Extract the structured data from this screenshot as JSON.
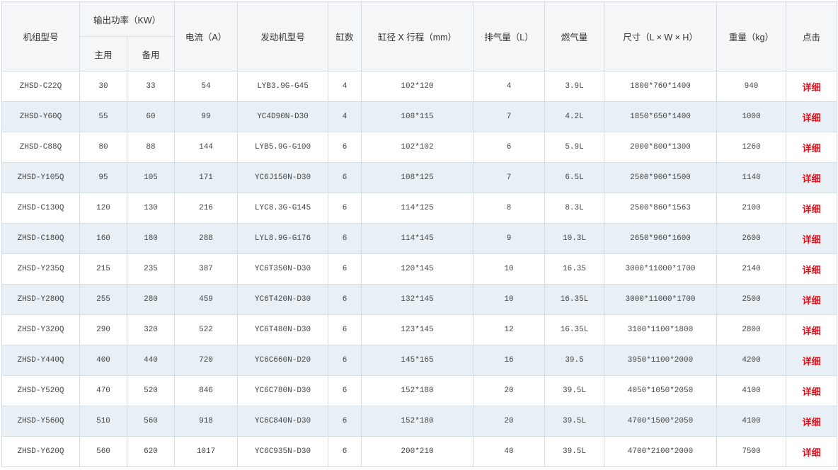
{
  "headers": {
    "model": "机组型号",
    "power": "输出功率（KW）",
    "main": "主用",
    "standby": "备用",
    "current": "电流（A）",
    "engine": "发动机型号",
    "cylinders": "缸数",
    "bore_stroke": "缸径 X 行程（mm）",
    "displacement": "排气量（L）",
    "fuel": "燃气量",
    "size": "尺寸（L × W × H）",
    "weight": "重量（kg）",
    "action": "点击"
  },
  "accent_color": "#e0101d",
  "row_stripe_color": "#e8f0f5",
  "rows": [
    {
      "model": "ZHSD-C22Q",
      "main": "30",
      "standby": "33",
      "current": "54",
      "engine": "LYB3.9G-G45",
      "cylinders": "4",
      "bore_stroke": "102*120",
      "displacement": "4",
      "fuel": "3.9L",
      "size": "1800*760*1400",
      "weight": "940",
      "detail": "详细"
    },
    {
      "model": "ZHSD-Y60Q",
      "main": "55",
      "standby": "60",
      "current": "99",
      "engine": "YC4D90N-D30",
      "cylinders": "4",
      "bore_stroke": "108*115",
      "displacement": "7",
      "fuel": "4.2L",
      "size": "1850*650*1400",
      "weight": "1000",
      "detail": "详细"
    },
    {
      "model": "ZHSD-C88Q",
      "main": "80",
      "standby": "88",
      "current": "144",
      "engine": "LYB5.9G-G100",
      "cylinders": "6",
      "bore_stroke": "102*102",
      "displacement": "6",
      "fuel": "5.9L",
      "size": "2000*800*1300",
      "weight": "1260",
      "detail": "详细"
    },
    {
      "model": "ZHSD-Y105Q",
      "main": "95",
      "standby": "105",
      "current": "171",
      "engine": "YC6J150N-D30",
      "cylinders": "6",
      "bore_stroke": "108*125",
      "displacement": "7",
      "fuel": "6.5L",
      "size": "2500*900*1500",
      "weight": "1140",
      "detail": "详细"
    },
    {
      "model": "ZHSD-C130Q",
      "main": "120",
      "standby": "130",
      "current": "216",
      "engine": "LYC8.3G-G145",
      "cylinders": "6",
      "bore_stroke": "114*125",
      "displacement": "8",
      "fuel": "8.3L",
      "size": "2500*860*1563",
      "weight": "2100",
      "detail": "详细"
    },
    {
      "model": "ZHSD-C180Q",
      "main": "160",
      "standby": "180",
      "current": "288",
      "engine": "LYL8.9G-G176",
      "cylinders": "6",
      "bore_stroke": "114*145",
      "displacement": "9",
      "fuel": "10.3L",
      "size": "2650*960*1600",
      "weight": "2600",
      "detail": "详细"
    },
    {
      "model": "ZHSD-Y235Q",
      "main": "215",
      "standby": "235",
      "current": "387",
      "engine": "YC6T350N-D30",
      "cylinders": "6",
      "bore_stroke": "120*145",
      "displacement": "10",
      "fuel": "16.35",
      "size": "3000*11000*1700",
      "weight": "2140",
      "detail": "详细"
    },
    {
      "model": "ZHSD-Y280Q",
      "main": "255",
      "standby": "280",
      "current": "459",
      "engine": "YC6T420N-D30",
      "cylinders": "6",
      "bore_stroke": "132*145",
      "displacement": "10",
      "fuel": "16.35L",
      "size": "3000*11000*1700",
      "weight": "2500",
      "detail": "详细"
    },
    {
      "model": "ZHSD-Y320Q",
      "main": "290",
      "standby": "320",
      "current": "522",
      "engine": "YC6T480N-D30",
      "cylinders": "6",
      "bore_stroke": "123*145",
      "displacement": "12",
      "fuel": "16.35L",
      "size": "3100*1100*1800",
      "weight": "2800",
      "detail": "详细"
    },
    {
      "model": "ZHSD-Y440Q",
      "main": "400",
      "standby": "440",
      "current": "720",
      "engine": "YC6C660N-D20",
      "cylinders": "6",
      "bore_stroke": "145*165",
      "displacement": "16",
      "fuel": "39.5",
      "size": "3950*1100*2000",
      "weight": "4200",
      "detail": "详细"
    },
    {
      "model": "ZHSD-Y520Q",
      "main": "470",
      "standby": "520",
      "current": "846",
      "engine": "YC6C780N-D30",
      "cylinders": "6",
      "bore_stroke": "152*180",
      "displacement": "20",
      "fuel": "39.5L",
      "size": "4050*1050*2050",
      "weight": "4100",
      "detail": "详细"
    },
    {
      "model": "ZHSD-Y560Q",
      "main": "510",
      "standby": "560",
      "current": "918",
      "engine": "YC6C840N-D30",
      "cylinders": "6",
      "bore_stroke": "152*180",
      "displacement": "20",
      "fuel": "39.5L",
      "size": "4700*1500*2050",
      "weight": "4100",
      "detail": "详细"
    },
    {
      "model": "ZHSD-Y620Q",
      "main": "560",
      "standby": "620",
      "current": "1017",
      "engine": "YC6C935N-D30",
      "cylinders": "6",
      "bore_stroke": "200*210",
      "displacement": "40",
      "fuel": "39.5L",
      "size": "4700*2100*2000",
      "weight": "7500",
      "detail": "详细"
    }
  ]
}
